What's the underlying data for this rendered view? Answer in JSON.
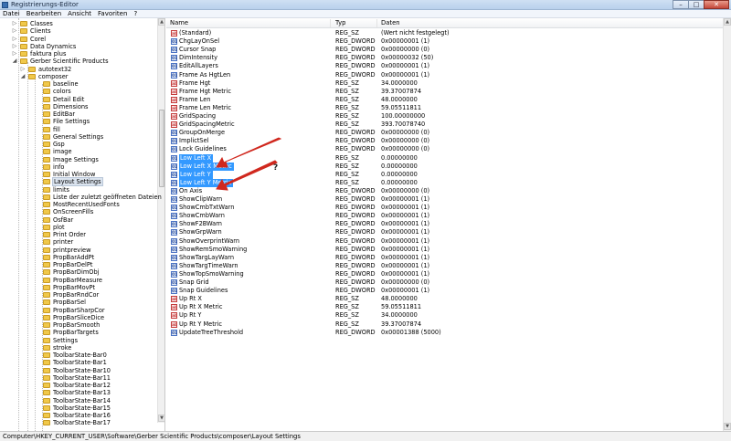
{
  "window": {
    "title": "Registrierungs-Editor",
    "minimize": "–",
    "maximize": "□",
    "close": "✕"
  },
  "menu": [
    "Datei",
    "Bearbeiten",
    "Ansicht",
    "Favoriten",
    "?"
  ],
  "tree": {
    "items": [
      {
        "label": "Classes",
        "level": 2,
        "expand": "▷"
      },
      {
        "label": "Clients",
        "level": 2,
        "expand": "▷"
      },
      {
        "label": "Corel",
        "level": 2,
        "expand": "▷"
      },
      {
        "label": "Data Dynamics",
        "level": 2,
        "expand": "▷"
      },
      {
        "label": "faktura plus",
        "level": 2,
        "expand": "▷"
      },
      {
        "label": "Gerber Scientific Products",
        "level": 2,
        "expand": "◢"
      },
      {
        "label": "autotext32",
        "level": 3,
        "expand": "▷"
      },
      {
        "label": "composer",
        "level": 3,
        "expand": "◢"
      },
      {
        "label": "baseline",
        "level": 4
      },
      {
        "label": "colors",
        "level": 4
      },
      {
        "label": "Detail Edit",
        "level": 4
      },
      {
        "label": "Dimensions",
        "level": 4
      },
      {
        "label": "EditBar",
        "level": 4
      },
      {
        "label": "File Settings",
        "level": 4
      },
      {
        "label": "fill",
        "level": 4
      },
      {
        "label": "General Settings",
        "level": 4
      },
      {
        "label": "Gsp",
        "level": 4
      },
      {
        "label": "image",
        "level": 4
      },
      {
        "label": "Image Settings",
        "level": 4
      },
      {
        "label": "info",
        "level": 4
      },
      {
        "label": "Initial Window",
        "level": 4
      },
      {
        "label": "Layout Settings",
        "level": 4,
        "selected": true
      },
      {
        "label": "limits",
        "level": 4
      },
      {
        "label": "Liste der zuletzt geöffneten Dateien",
        "level": 4
      },
      {
        "label": "MostRecentUsedFonts",
        "level": 4
      },
      {
        "label": "OnScreenFills",
        "level": 4
      },
      {
        "label": "OsfBar",
        "level": 4
      },
      {
        "label": "plot",
        "level": 4
      },
      {
        "label": "Print Order",
        "level": 4
      },
      {
        "label": "printer",
        "level": 4
      },
      {
        "label": "printpreview",
        "level": 4
      },
      {
        "label": "PropBarAddPt",
        "level": 4
      },
      {
        "label": "PropBarDelPt",
        "level": 4
      },
      {
        "label": "PropBarDimObj",
        "level": 4
      },
      {
        "label": "PropBarMeasure",
        "level": 4
      },
      {
        "label": "PropBarMovPt",
        "level": 4
      },
      {
        "label": "PropBarRndCor",
        "level": 4
      },
      {
        "label": "PropBarSel",
        "level": 4
      },
      {
        "label": "PropBarSharpCor",
        "level": 4
      },
      {
        "label": "PropBarSliceDice",
        "level": 4
      },
      {
        "label": "PropBarSmooth",
        "level": 4
      },
      {
        "label": "PropBarTargets",
        "level": 4
      },
      {
        "label": "Settings",
        "level": 4
      },
      {
        "label": "stroke",
        "level": 4
      },
      {
        "label": "ToolbarState-Bar0",
        "level": 4
      },
      {
        "label": "ToolbarState-Bar1",
        "level": 4
      },
      {
        "label": "ToolbarState-Bar10",
        "level": 4
      },
      {
        "label": "ToolbarState-Bar11",
        "level": 4
      },
      {
        "label": "ToolbarState-Bar12",
        "level": 4
      },
      {
        "label": "ToolbarState-Bar13",
        "level": 4
      },
      {
        "label": "ToolbarState-Bar14",
        "level": 4
      },
      {
        "label": "ToolbarState-Bar15",
        "level": 4
      },
      {
        "label": "ToolbarState-Bar16",
        "level": 4
      },
      {
        "label": "ToolbarState-Bar17",
        "level": 4
      }
    ]
  },
  "columns": {
    "name": "Name",
    "type": "Typ",
    "data": "Daten"
  },
  "values": [
    {
      "name": "(Standard)",
      "type": "REG_SZ",
      "data": "(Wert nicht festgelegt)",
      "icon": "ab"
    },
    {
      "name": "ChgLayOnSel",
      "type": "REG_DWORD",
      "data": "0x00000001 (1)",
      "icon": "dword"
    },
    {
      "name": "Cursor Snap",
      "type": "REG_DWORD",
      "data": "0x00000000 (0)",
      "icon": "dword"
    },
    {
      "name": "DimIntensity",
      "type": "REG_DWORD",
      "data": "0x00000032 (50)",
      "icon": "dword"
    },
    {
      "name": "EditAllLayers",
      "type": "REG_DWORD",
      "data": "0x00000001 (1)",
      "icon": "dword"
    },
    {
      "name": "Frame As HgtLen",
      "type": "REG_DWORD",
      "data": "0x00000001 (1)",
      "icon": "dword"
    },
    {
      "name": "Frame Hgt",
      "type": "REG_SZ",
      "data": "34.0000000",
      "icon": "ab"
    },
    {
      "name": "Frame Hgt Metric",
      "type": "REG_SZ",
      "data": "39.37007874",
      "icon": "ab"
    },
    {
      "name": "Frame Len",
      "type": "REG_SZ",
      "data": "48.0000000",
      "icon": "ab"
    },
    {
      "name": "Frame Len Metric",
      "type": "REG_SZ",
      "data": "59.05511811",
      "icon": "ab"
    },
    {
      "name": "GridSpacing",
      "type": "REG_SZ",
      "data": "100.00000000",
      "icon": "ab"
    },
    {
      "name": "GridSpacingMetric",
      "type": "REG_SZ",
      "data": "393.70078740",
      "icon": "ab"
    },
    {
      "name": "GroupOnMerge",
      "type": "REG_DWORD",
      "data": "0x00000000 (0)",
      "icon": "dword"
    },
    {
      "name": "ImplictSel",
      "type": "REG_DWORD",
      "data": "0x00000000 (0)",
      "icon": "dword"
    },
    {
      "name": "Lock Guidelines",
      "type": "REG_DWORD",
      "data": "0x00000000 (0)",
      "icon": "dword"
    },
    {
      "name": "Low Left X",
      "type": "REG_SZ",
      "data": "0.00000000",
      "icon": "dword",
      "highlight": true
    },
    {
      "name": "Low Left X Metric",
      "type": "REG_SZ",
      "data": "0.00000000",
      "icon": "dword",
      "highlight": true
    },
    {
      "name": "Low Left Y",
      "type": "REG_SZ",
      "data": "0.00000000",
      "icon": "dword",
      "highlight": true
    },
    {
      "name": "Low Left Y Metric",
      "type": "REG_SZ",
      "data": "0.00000000",
      "icon": "dword",
      "highlight": true
    },
    {
      "name": "On Axis",
      "type": "REG_DWORD",
      "data": "0x00000000 (0)",
      "icon": "dword"
    },
    {
      "name": "ShowClipWarn",
      "type": "REG_DWORD",
      "data": "0x00000001 (1)",
      "icon": "dword"
    },
    {
      "name": "ShowCmbTxtWarn",
      "type": "REG_DWORD",
      "data": "0x00000001 (1)",
      "icon": "dword"
    },
    {
      "name": "ShowCmbWarn",
      "type": "REG_DWORD",
      "data": "0x00000001 (1)",
      "icon": "dword"
    },
    {
      "name": "ShowF2BWarn",
      "type": "REG_DWORD",
      "data": "0x00000001 (1)",
      "icon": "dword"
    },
    {
      "name": "ShowGrpWarn",
      "type": "REG_DWORD",
      "data": "0x00000001 (1)",
      "icon": "dword"
    },
    {
      "name": "ShowOverprintWarn",
      "type": "REG_DWORD",
      "data": "0x00000001 (1)",
      "icon": "dword"
    },
    {
      "name": "ShowRemSmoWarning",
      "type": "REG_DWORD",
      "data": "0x00000001 (1)",
      "icon": "dword"
    },
    {
      "name": "ShowTargLayWarn",
      "type": "REG_DWORD",
      "data": "0x00000001 (1)",
      "icon": "dword"
    },
    {
      "name": "ShowTargTimeWarn",
      "type": "REG_DWORD",
      "data": "0x00000001 (1)",
      "icon": "dword"
    },
    {
      "name": "ShowTopSmoWarning",
      "type": "REG_DWORD",
      "data": "0x00000001 (1)",
      "icon": "dword"
    },
    {
      "name": "Snap Grid",
      "type": "REG_DWORD",
      "data": "0x00000000 (0)",
      "icon": "dword"
    },
    {
      "name": "Snap Guidelines",
      "type": "REG_DWORD",
      "data": "0x00000001 (1)",
      "icon": "dword"
    },
    {
      "name": "Up Rt X",
      "type": "REG_SZ",
      "data": "48.0000000",
      "icon": "ab"
    },
    {
      "name": "Up Rt X Metric",
      "type": "REG_SZ",
      "data": "59.05511811",
      "icon": "ab"
    },
    {
      "name": "Up Rt Y",
      "type": "REG_SZ",
      "data": "34.0000000",
      "icon": "ab"
    },
    {
      "name": "Up Rt Y Metric",
      "type": "REG_SZ",
      "data": "39.37007874",
      "icon": "ab"
    },
    {
      "name": "UpdateTreeThreshold",
      "type": "REG_DWORD",
      "data": "0x00001388 (5000)",
      "icon": "dword"
    }
  ],
  "annotation": {
    "mark": "?",
    "color": "#d0281e"
  },
  "statusbar": {
    "path": "Computer\\HKEY_CURRENT_USER\\Software\\Gerber Scientific Products\\composer\\Layout Settings"
  }
}
